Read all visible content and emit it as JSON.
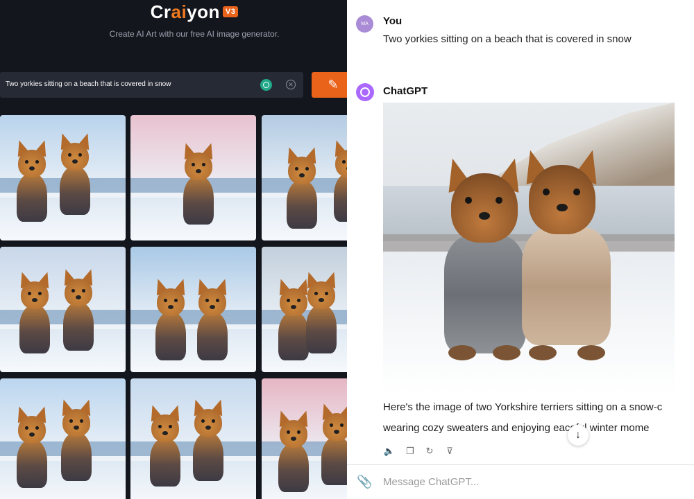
{
  "craiyon": {
    "logo_pre": "Cr",
    "logo_ai": "ai",
    "logo_post": "yon",
    "version_badge": "V3",
    "tagline": "Create AI Art with our free AI image generator.",
    "prompt_value": "Two yorkies sitting on a beach that is covered in snow",
    "clear_symbol": "✕",
    "draw_symbol": "✎",
    "brand_color": "#e9631b"
  },
  "chatgpt": {
    "user_avatar_initials": "MA",
    "user_name": "You",
    "user_message": "Two yorkies sitting on a beach that is covered in snow",
    "bot_name": "ChatGPT",
    "reply_line1": "Here's the image of two Yorkshire terriers sitting on a snow-c",
    "reply_line2": "wearing cozy sweaters and enjoying  eaceful winter mome",
    "scroll_symbol": "↓",
    "actions": [
      {
        "name": "read-aloud-icon",
        "symbol": "🔈"
      },
      {
        "name": "copy-icon",
        "symbol": "❐"
      },
      {
        "name": "regenerate-icon",
        "symbol": "↻"
      },
      {
        "name": "thumbs-down-icon",
        "symbol": "⊽"
      }
    ],
    "attach_symbol": "📎",
    "input_placeholder": "Message ChatGPT..."
  }
}
